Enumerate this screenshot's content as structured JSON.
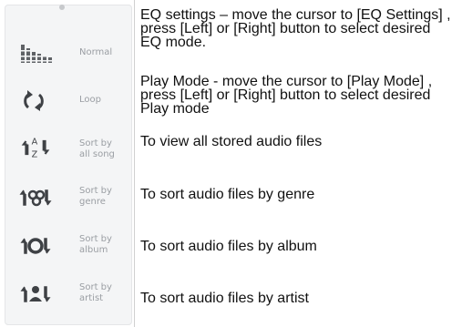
{
  "menu": {
    "items": [
      {
        "label": "Normal",
        "icon": "equalizer-icon"
      },
      {
        "label": "Loop",
        "icon": "loop-icon"
      },
      {
        "label": "Sort by all song",
        "icon": "sort-az-icon"
      },
      {
        "label": "Sort by genre",
        "icon": "genre-icon"
      },
      {
        "label": "Sort by album",
        "icon": "album-icon"
      },
      {
        "label": "Sort by artist",
        "icon": "artist-icon"
      }
    ]
  },
  "descriptions": [
    "EQ settings – move the cursor to [EQ Settings] , press [Left] or [Right] button to select desired EQ mode.",
    "Play Mode - move the cursor to [Play Mode] , press [Left] or [Right] button to select desired Play mode",
    "To view all stored audio files",
    "To sort audio files by genre",
    "To sort audio files by album",
    "To sort audio files by artist"
  ]
}
